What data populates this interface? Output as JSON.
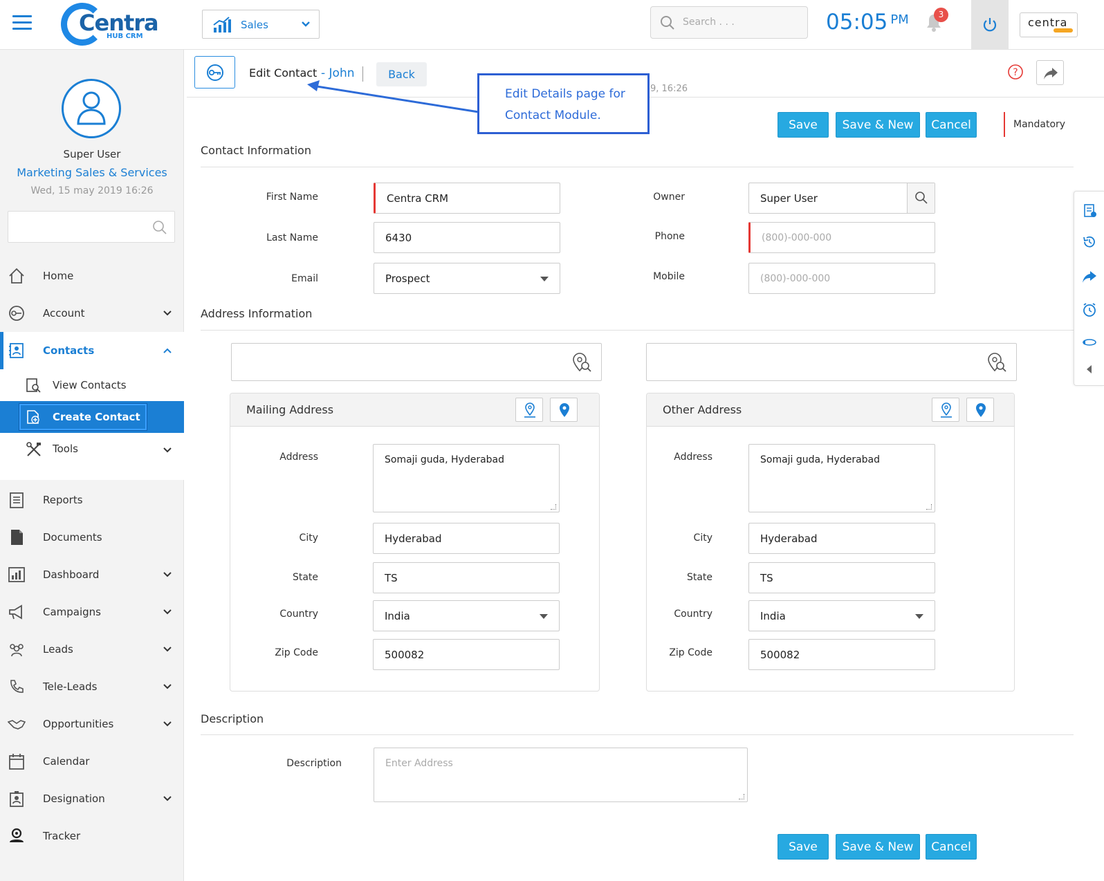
{
  "topbar": {
    "logo_text": "Centra",
    "logo_sub": "HUB CRM",
    "module": "Sales",
    "search_placeholder": "Search . . .",
    "time": "05:05",
    "ampm": "PM",
    "notification_count": "3",
    "brand": "centra"
  },
  "user": {
    "name": "Super User",
    "role": "Marketing Sales & Services",
    "date": "Wed, 15 may 2019 16:26"
  },
  "nav": {
    "home": "Home",
    "account": "Account",
    "contacts": "Contacts",
    "view_contacts": "View Contacts",
    "create_contact": "Create Contact",
    "tools": "Tools",
    "reports": "Reports",
    "documents": "Documents",
    "dashboard": "Dashboard",
    "campaigns": "Campaigns",
    "leads": "Leads",
    "tele_leads": "Tele-Leads",
    "opportunities": "Opportunities",
    "calendar": "Calendar",
    "designation": "Designation",
    "tracker": "Tracker"
  },
  "header": {
    "title": "Edit Contact",
    "name": "- John",
    "back": "Back",
    "partial_date": "9, 16:26"
  },
  "callout": {
    "line1": "Edit Details page for",
    "line2": "Contact Module."
  },
  "actions": {
    "save": "Save",
    "save_new": "Save & New",
    "cancel": "Cancel",
    "mandatory": "Mandatory"
  },
  "contact_info": {
    "title": "Contact Information",
    "first_name_label": "First Name",
    "first_name": "Centra CRM",
    "last_name_label": "Last Name",
    "last_name": "6430",
    "email_label": "Email",
    "email": "Prospect",
    "owner_label": "Owner",
    "owner": "Super User",
    "phone_label": "Phone",
    "phone_placeholder": "(800)-000-000",
    "mobile_label": "Mobile",
    "mobile_placeholder": "(800)-000-000"
  },
  "address_info": {
    "title": "Address Information",
    "mailing": {
      "title": "Mailing Address",
      "address_label": "Address",
      "address": "Somaji guda, Hyderabad",
      "city_label": "City",
      "city": "Hyderabad",
      "state_label": "State",
      "state": "TS",
      "country_label": "Country",
      "country": "India",
      "zip_label": "Zip Code",
      "zip": "500082"
    },
    "other": {
      "title": "Other Address",
      "address_label": "Address",
      "address": "Somaji guda, Hyderabad",
      "city_label": "City",
      "city": "Hyderabad",
      "state_label": "State",
      "state": "TS",
      "country_label": "Country",
      "country": "India",
      "zip_label": "Zip Code",
      "zip": "500082"
    }
  },
  "description": {
    "title": "Description",
    "label": "Description",
    "placeholder": "Enter Address"
  },
  "colors": {
    "primary": "#1b7fd4",
    "button": "#27a9e1",
    "required": "#e53935",
    "callout": "#2d5fd3"
  }
}
